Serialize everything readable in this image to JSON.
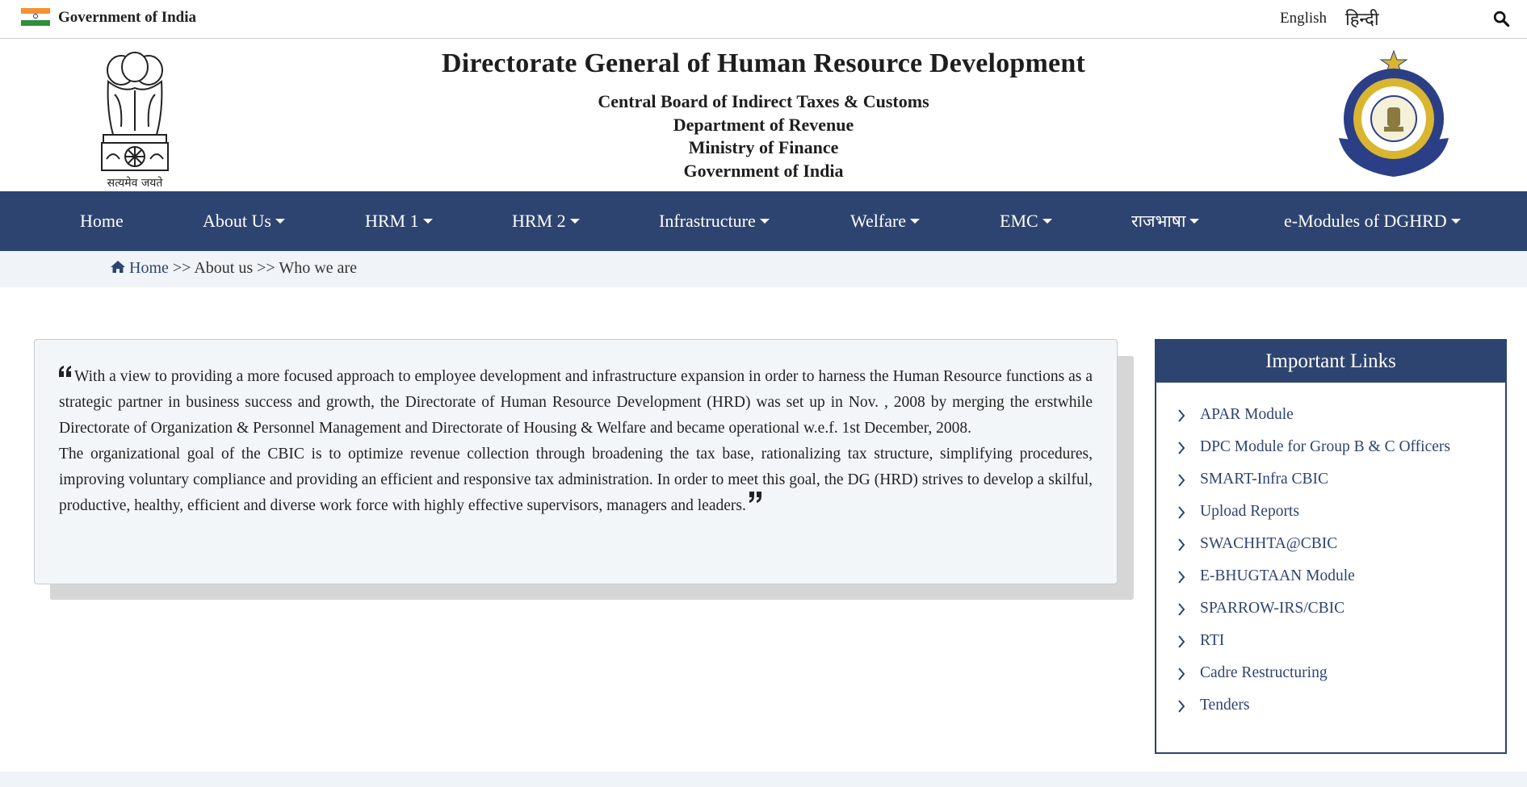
{
  "topbar": {
    "gov_label": "Government of India",
    "lang_english": "English",
    "lang_hindi": "हिन्दी"
  },
  "header": {
    "title": "Directorate General of Human Resource Development",
    "sub1": "Central Board of Indirect Taxes & Customs",
    "sub2": "Department of Revenue",
    "sub3": "Ministry of Finance",
    "sub4": "Government of India",
    "emblem_motto": "सत्यमेव जयते"
  },
  "nav": {
    "items": [
      {
        "label": "Home",
        "dropdown": false
      },
      {
        "label": "About Us",
        "dropdown": true
      },
      {
        "label": "HRM 1",
        "dropdown": true
      },
      {
        "label": "HRM 2",
        "dropdown": true
      },
      {
        "label": "Infrastructure",
        "dropdown": true
      },
      {
        "label": "Welfare",
        "dropdown": true
      },
      {
        "label": "EMC",
        "dropdown": true
      },
      {
        "label": "राजभाषा",
        "dropdown": true
      },
      {
        "label": "e-Modules of DGHRD",
        "dropdown": true
      }
    ]
  },
  "breadcrumb": {
    "home": "Home",
    "sep1": " >> ",
    "about": "About us",
    "sep2": " >> ",
    "current": "Who we are"
  },
  "content": {
    "para1": "With a view to providing a more focused approach to employee development and infrastructure expansion in order to harness the Human Resource functions as a strategic partner in business success and growth, the Directorate of Human Resource Development (HRD) was set up in Nov. , 2008 by merging the erstwhile Directorate of Organization & Personnel Management and Directorate of Housing & Welfare and became operational w.e.f. 1st December, 2008.",
    "para2": "The organizational goal of the CBIC is to optimize revenue collection through broadening the tax base, rationalizing tax structure, simplifying procedures, improving voluntary compliance and providing an efficient and responsive tax administration. In order to meet this goal, the DG (HRD) strives to develop a skilful, productive, healthy, efficient and diverse work force with highly effective supervisors, managers and leaders."
  },
  "important_links": {
    "title": "Important Links",
    "items": [
      "APAR Module",
      "DPC Module for Group B & C Officers",
      "SMART-Infra CBIC",
      "Upload Reports",
      "SWACHHTA@CBIC",
      "E-BHUGTAAN Module",
      "SPARROW-IRS/CBIC",
      "RTI",
      "Cadre Restructuring",
      "Tenders"
    ]
  },
  "colors": {
    "primary": "#2d4470",
    "crumb_bg": "#f0f4f8",
    "card_bg": "#f3f6f9"
  }
}
